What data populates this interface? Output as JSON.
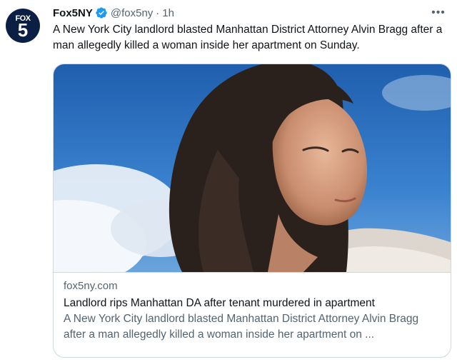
{
  "avatar": {
    "line1": "FOX",
    "line2": "5"
  },
  "header": {
    "name": "Fox5NY",
    "handle": "@fox5ny",
    "separator": "·",
    "time": "1h",
    "more_label": "•••"
  },
  "tweet": {
    "text": "A New York City landlord blasted Manhattan District Attorney Alvin Bragg after a man allegedly killed a woman inside her apartment on Sunday."
  },
  "card": {
    "image_icon": "news-photo",
    "domain": "fox5ny.com",
    "title": "Landlord rips Manhattan DA after tenant murdered in apartment",
    "description": "A New York City landlord blasted Manhattan District Attorney Alvin Bragg after a man allegedly killed a woman inside her apartment on ..."
  },
  "colors": {
    "avatar_bg": "#0b1f44",
    "verified": "#1d9bf0",
    "secondary_text": "#536471",
    "border": "#cfd9de",
    "sky": "#2f74c4"
  }
}
